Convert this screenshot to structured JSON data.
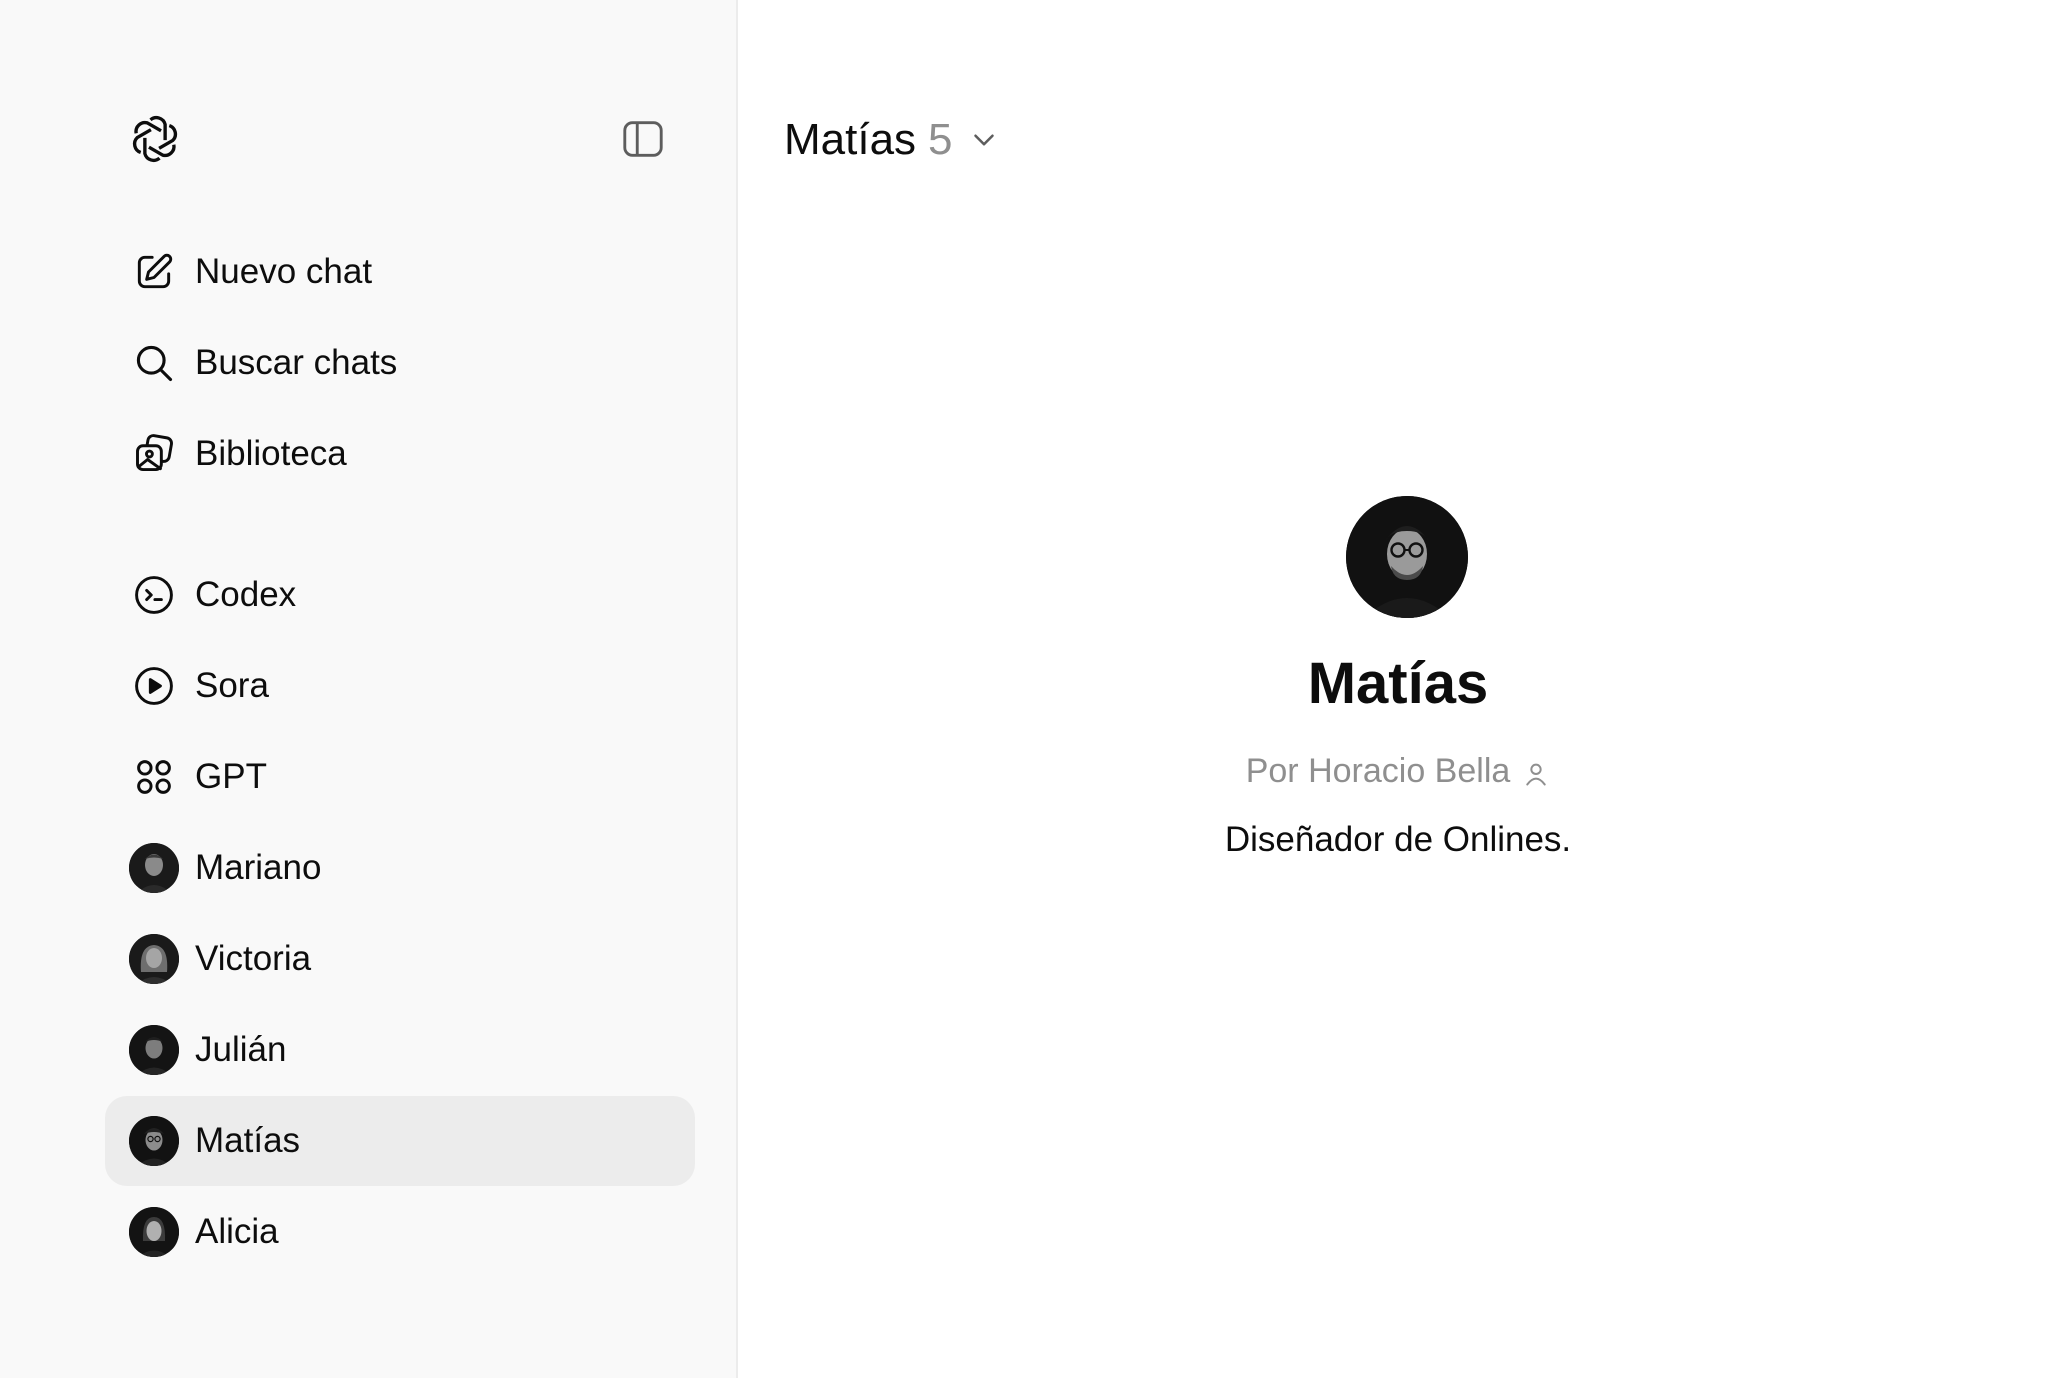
{
  "sidebar": {
    "logo_icon": "openai-logo-icon",
    "toggle_icon": "sidebar-toggle-icon",
    "actions": [
      {
        "label": "Nuevo chat",
        "icon": "new-chat-icon"
      },
      {
        "label": "Buscar chats",
        "icon": "search-icon"
      },
      {
        "label": "Biblioteca",
        "icon": "library-icon"
      }
    ],
    "apps": [
      {
        "label": "Codex",
        "icon": "codex-icon"
      },
      {
        "label": "Sora",
        "icon": "play-icon"
      },
      {
        "label": "GPT",
        "icon": "grid-icon"
      }
    ],
    "gpts": [
      {
        "label": "Mariano",
        "icon": "avatar"
      },
      {
        "label": "Victoria",
        "icon": "avatar"
      },
      {
        "label": "Julián",
        "icon": "avatar"
      },
      {
        "label": "Matías",
        "icon": "avatar",
        "active": true
      },
      {
        "label": "Alicia",
        "icon": "avatar"
      }
    ]
  },
  "header": {
    "model_name": "Matías",
    "model_version": "5"
  },
  "profile": {
    "name": "Matías",
    "author": "Por Horacio Bella",
    "description": "Diseñador de Onlines."
  },
  "colors": {
    "sidebar_bg": "#f9f9f9",
    "active_item_bg": "#ececec",
    "text_primary": "#0d0d0d",
    "text_secondary": "#8f8f8f"
  }
}
